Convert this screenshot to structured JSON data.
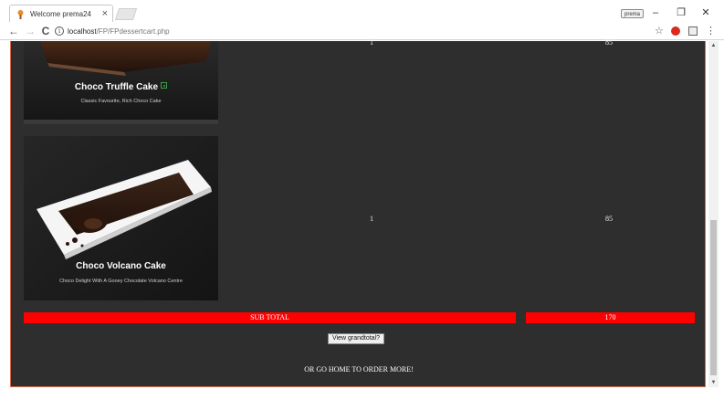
{
  "browser": {
    "tab_title": "Welcome prema24",
    "tab_close": "×",
    "profile_label": "prema",
    "window_minimize": "–",
    "window_restore": "❐",
    "window_close": "✕",
    "back_icon": "←",
    "forward_icon": "→",
    "reload_icon": "C",
    "url_host": "localhost",
    "url_path": "/FP/FPdessertcart.php",
    "star_icon": "☆",
    "menu_icon": "⋮"
  },
  "cart": {
    "items": [
      {
        "name": "Choco Truffle Cake",
        "subtitle": "Classic Favourite, Rich Choco Cake",
        "quantity": "1",
        "price": "85"
      },
      {
        "name": "Choco Volcano Cake",
        "subtitle": "Choco Delight With A Gooey Chocolate Volcano Centre",
        "quantity": "1",
        "price": "85"
      }
    ],
    "subtotal_label": "SUB TOTAL",
    "subtotal_value": "170",
    "grand_total_button": "View grandtotal?",
    "home_link": "OR GO HOME TO ORDER MORE!"
  },
  "colors": {
    "page_background": "#2e2e2e",
    "total_bar": "#ff0000",
    "panel_border": "#d9694c",
    "veg_mark": "#3fa047"
  },
  "icons": {
    "tab_favicon": "dessert-favicon",
    "info": "info-icon",
    "extension_red": "adblock-icon",
    "extension_box": "cast-icon"
  }
}
